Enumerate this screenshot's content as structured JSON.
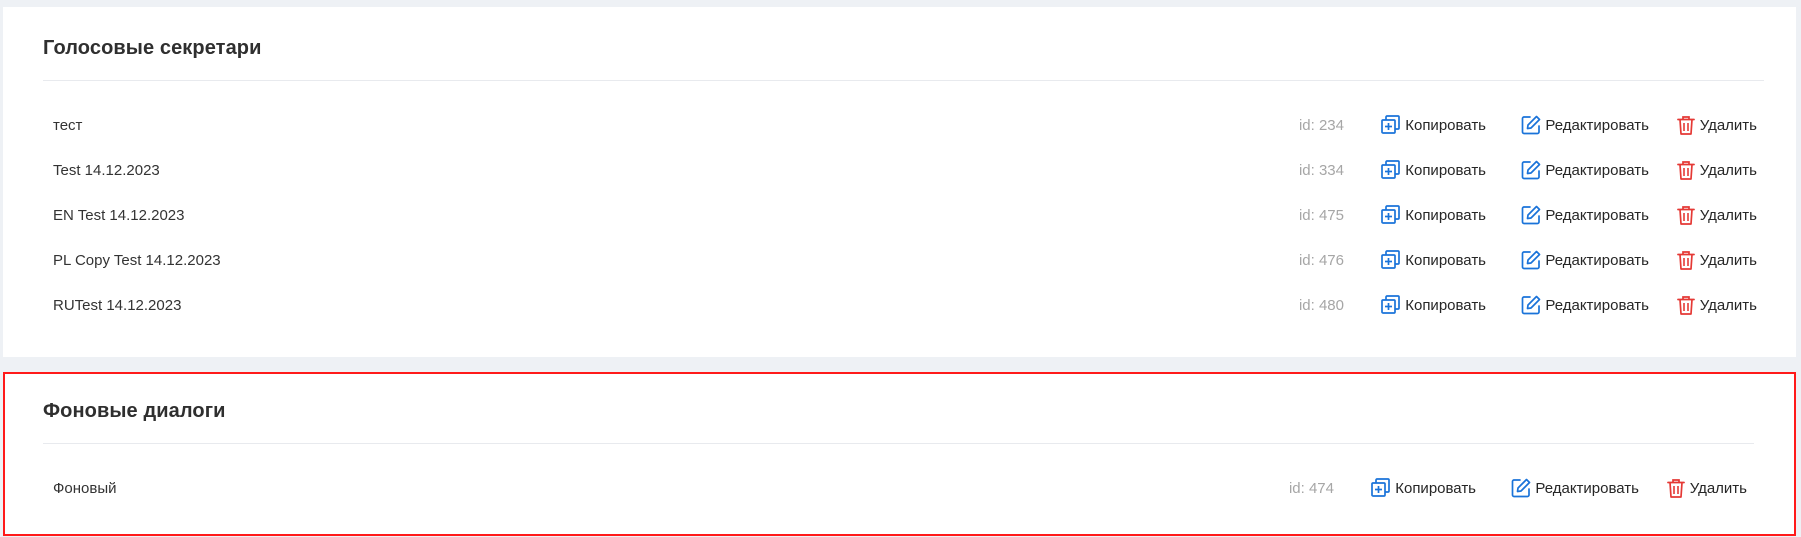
{
  "sections": [
    {
      "title": "Голосовые секретари",
      "rows": [
        {
          "name": "тест",
          "id_label": "id: 234"
        },
        {
          "name": "Test 14.12.2023",
          "id_label": "id: 334"
        },
        {
          "name": "EN Test 14.12.2023",
          "id_label": "id: 475"
        },
        {
          "name": "PL Copy Test 14.12.2023",
          "id_label": "id: 476"
        },
        {
          "name": "RUTest 14.12.2023",
          "id_label": "id: 480"
        }
      ]
    },
    {
      "title": "Фоновые диалоги",
      "highlighted": true,
      "rows": [
        {
          "name": "Фоновый",
          "id_label": "id: 474"
        }
      ]
    }
  ],
  "actions": {
    "copy_label": "Копировать",
    "edit_label": "Редактировать",
    "delete_label": "Удалить"
  },
  "icons": {
    "copy": "copy-icon",
    "edit": "edit-icon",
    "delete": "trash-icon"
  },
  "colors": {
    "page_background": "#eef1f5",
    "panel_background": "#ffffff",
    "action_icon_blue": "#1a73d9",
    "delete_icon_red": "#e53935",
    "highlight_border": "#ff1a1a",
    "id_text": "#a6a6a6"
  }
}
